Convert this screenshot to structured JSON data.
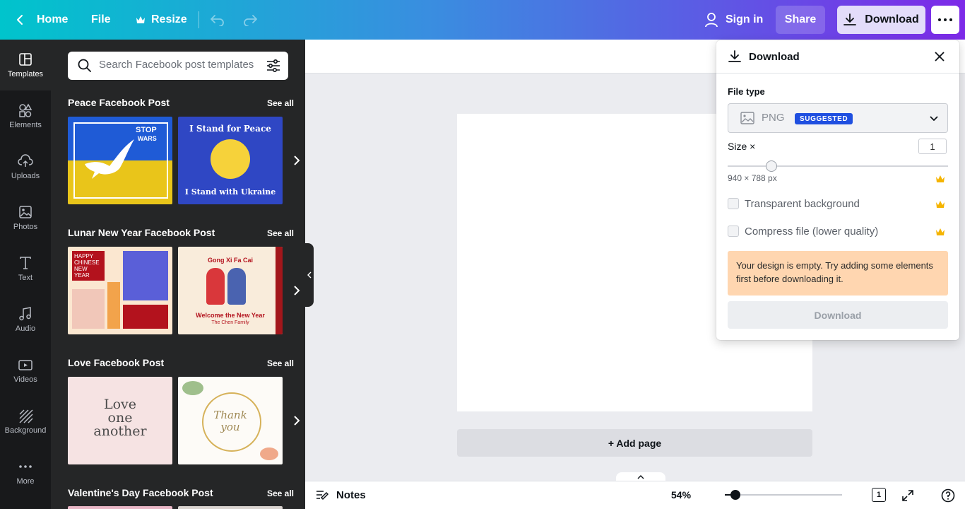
{
  "topbar": {
    "home": "Home",
    "file": "File",
    "resize": "Resize",
    "sign_in": "Sign in",
    "share": "Share",
    "download": "Download"
  },
  "rail": {
    "items": [
      {
        "label": "Templates",
        "icon": "templates-icon",
        "active": true
      },
      {
        "label": "Elements",
        "icon": "elements-icon"
      },
      {
        "label": "Uploads",
        "icon": "uploads-icon"
      },
      {
        "label": "Photos",
        "icon": "photos-icon"
      },
      {
        "label": "Text",
        "icon": "text-icon"
      },
      {
        "label": "Audio",
        "icon": "audio-icon"
      },
      {
        "label": "Videos",
        "icon": "videos-icon"
      },
      {
        "label": "Background",
        "icon": "background-icon"
      },
      {
        "label": "More",
        "icon": "more-icon"
      }
    ]
  },
  "templates": {
    "search_placeholder": "Search Facebook post templates",
    "see_all": "See all",
    "sections": [
      {
        "title": "Peace Facebook Post",
        "thumbs": [
          {
            "lines": [
              "STOP",
              "WARS"
            ]
          },
          {
            "lines": [
              "I Stand for Peace",
              "I Stand with Ukraine"
            ]
          }
        ]
      },
      {
        "title": "Lunar New Year Facebook Post",
        "thumbs": [
          {
            "lines": [
              "HAPPY",
              "CHINESE",
              "NEW YEAR"
            ]
          },
          {
            "lines": [
              "Gong Xi Fa Cai",
              "Welcome the New Year",
              "The Chen Family"
            ]
          }
        ]
      },
      {
        "title": "Love Facebook Post",
        "thumbs": [
          {
            "lines": [
              "Love",
              "one",
              "another"
            ]
          },
          {
            "lines": [
              "Thank",
              "you"
            ]
          }
        ]
      },
      {
        "title": "Valentine's Day Facebook Post"
      }
    ]
  },
  "canvas": {
    "add_page": "+ Add page"
  },
  "bottombar": {
    "notes": "Notes",
    "zoom": "54%",
    "page_count": "1"
  },
  "download_panel": {
    "title": "Download",
    "file_type_label": "File type",
    "file_type_value": "PNG",
    "badge": "SUGGESTED",
    "size_label": "Size ×",
    "size_value": "1",
    "dimensions": "940 × 788 px",
    "transparent_bg": "Transparent background",
    "compress": "Compress file (lower quality)",
    "warning": "Your design is empty. Try adding some elements first before downloading it.",
    "button": "Download"
  },
  "colors": {
    "gradient_start": "#00c4cc",
    "gradient_end": "#7d2ae8",
    "badge": "#1f4fe0",
    "warning_bg": "#ffd6b0",
    "crown": "#f5b400"
  }
}
